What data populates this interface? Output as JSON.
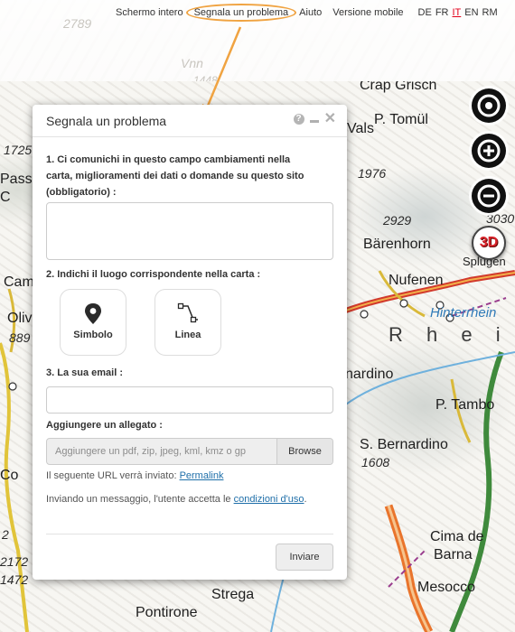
{
  "header": {
    "nav": [
      {
        "label": "Schermo intero"
      },
      {
        "label": "Segnala un problema"
      },
      {
        "label": "Aiuto"
      },
      {
        "label": "Versione mobile"
      }
    ],
    "languages": [
      "DE",
      "FR",
      "IT",
      "EN",
      "RM"
    ],
    "active_language": "IT",
    "highlight_color": "#f0a341"
  },
  "map": {
    "labels": {
      "top_num1": "2789",
      "top_num2": "1448",
      "vnn": "Vnn",
      "crap_grisch": "Crap Grisch",
      "p_tomul": "P. Tomül",
      "vals": "Vals",
      "n1976": "1976",
      "n2929": "2929",
      "barenhorn": "Bärenhorn",
      "nufenen": "Nufenen",
      "hinterrhein": "Hinterrhein",
      "rhein": "R h e i n",
      "nardino": "nardino",
      "p_tambo": "P. Tambo",
      "s_bernardino": "S. Bernardino",
      "n1608": "1608",
      "cima": "Cima de",
      "barna": "Barna",
      "mesocco": "Mesocco",
      "strega": "Strega",
      "pontirone": "Pontirone",
      "spluga": "Splügen",
      "n3030": "3030",
      "left_cam": "Cam",
      "left_oliv": "Oliv",
      "left_889": "889",
      "left_passo": "Passo",
      "left_c": "C",
      "left_co": "Co",
      "left_n1725": "1725",
      "left_n2172": "2172",
      "left_n1472": "1472",
      "left_n2": "2"
    }
  },
  "controls": {
    "three_d_label": "3D"
  },
  "dialog": {
    "title": "Segnala un problema",
    "help_symbol": "?",
    "q1": "1. Ci comunichi in questo campo cambiamenti nella carta, miglioramenti dei dati o domande su questo sito (obbligatorio) :",
    "q2": "2. Indichi il luogo corrispondente nella carta :",
    "tool_symbol": "Simbolo",
    "tool_line": "Linea",
    "q3": "3. La sua email :",
    "attachment_label": "Aggiungere un allegato :",
    "attachment_placeholder": "Aggiungere un pdf, zip, jpeg, kml, kmz o gp",
    "browse_label": "Browse",
    "url_note_prefix": "Il seguente URL verrà inviato: ",
    "permalink_label": "Permalink",
    "terms_prefix": "Inviando un messaggio, l'utente accetta le ",
    "terms_link": "condizioni d'uso",
    "terms_suffix": ".",
    "send_label": "Inviare"
  }
}
